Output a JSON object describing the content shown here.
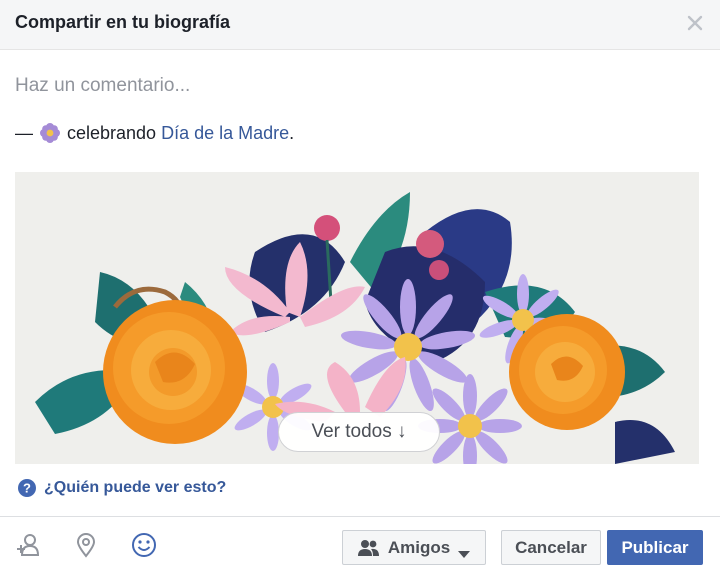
{
  "dialog": {
    "title": "Compartir en tu biografía",
    "close_icon": "close-icon"
  },
  "composer": {
    "placeholder": "Haz un comentario...",
    "value": ""
  },
  "feeling": {
    "dash": "—",
    "icon": "flower-icon",
    "verb": "celebrando",
    "event": "Día de la Madre",
    "end": "."
  },
  "artwork": {
    "see_all_label": "Ver todos ↓"
  },
  "privacy_help": {
    "icon": "question-icon",
    "label": "¿Quién puede ver esto?"
  },
  "footer": {
    "icons": [
      "tag-friends-icon",
      "location-pin-icon",
      "smiley-icon"
    ],
    "audience_label": "Amigos",
    "audience_icon": "friends-icon",
    "cancel_label": "Cancelar",
    "publish_label": "Publicar"
  },
  "colors": {
    "link": "#365899",
    "primary": "#4267b2",
    "header_bg": "#f5f6f7"
  }
}
